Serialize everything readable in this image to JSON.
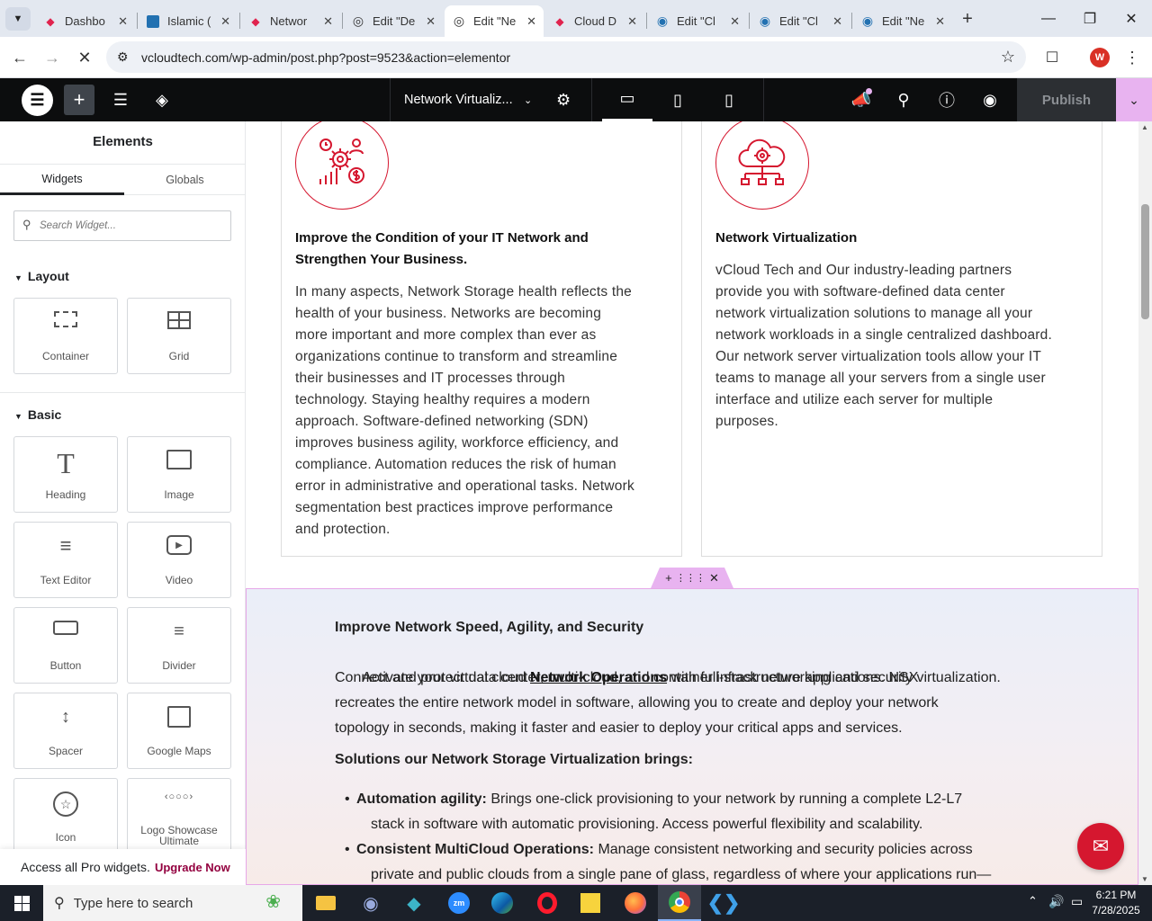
{
  "browser": {
    "tabs": [
      {
        "title": "Dashbo",
        "icon": "diamond-icon",
        "color": "#e0234e"
      },
      {
        "title": "Islamic (",
        "icon": "wp-icon",
        "color": "#2271b1"
      },
      {
        "title": "Networ",
        "icon": "diamond-icon",
        "color": "#e0234e"
      },
      {
        "title": "Edit \"De",
        "icon": "elementor-icon",
        "color": "#333"
      },
      {
        "title": "Edit \"Ne",
        "icon": "elementor-icon",
        "color": "#333"
      },
      {
        "title": "Cloud D",
        "icon": "diamond-icon",
        "color": "#e0234e"
      },
      {
        "title": "Edit \"Cl",
        "icon": "wp-icon",
        "color": "#2271b1"
      },
      {
        "title": "Edit \"Cl",
        "icon": "wp-icon",
        "color": "#2271b1"
      },
      {
        "title": "Edit \"Ne",
        "icon": "wp-icon",
        "color": "#2271b1"
      }
    ],
    "active_tab": 4,
    "url": "vcloudtech.com/wp-admin/post.php?post=9523&action=elementor",
    "profile_letter": "W"
  },
  "editor": {
    "page_title": "Network Virtualiz...",
    "publish_label": "Publish"
  },
  "panel": {
    "title": "Elements",
    "tab_widgets": "Widgets",
    "tab_globals": "Globals",
    "search_placeholder": "Search Widget...",
    "layout_label": "Layout",
    "basic_label": "Basic",
    "layout_items": [
      "Container",
      "Grid"
    ],
    "basic_items": [
      "Heading",
      "Image",
      "Text Editor",
      "Video",
      "Button",
      "Divider",
      "Spacer",
      "Google Maps",
      "Icon",
      "Logo Showcase Ultimate"
    ],
    "promo_text": "Access all Pro widgets.",
    "promo_link": "Upgrade Now"
  },
  "content": {
    "left": {
      "title_line1": "Improve the Condition of your IT Network and",
      "title_line2": "Strengthen Your Business.",
      "lines": [
        "In many aspects, Network Storage health reflects the",
        "health of your business. Networks are becoming",
        "more important and more complex than ever as",
        "organizations continue to transform and streamline",
        "their businesses and IT processes through",
        "technology. Staying healthy requires a modern",
        "approach. Software-defined networking (SDN)",
        "improves business agility, workforce efficiency, and",
        "compliance. Automation reduces the risk of human",
        "error in administrative and operational tasks. Network",
        "segmentation best practices improve performance",
        "and protection."
      ]
    },
    "right": {
      "title": "Network Virtualization",
      "lines": [
        "vCloud Tech and Our industry-leading partners",
        "provide you with software-defined data center",
        "network virtualization solutions to manage all your",
        "network workloads in a single centralized dashboard.",
        "Our network server virtualization tools allow your IT",
        "teams to manage all your servers from a single user",
        "interface and utilize each server for multiple",
        "purposes."
      ]
    },
    "section2": {
      "heading": "Improve Network Speed, Agility, and Security",
      "p1_pre": " Activate your virtual cloud ",
      "p1_link": "Network Operations",
      "p1_post": " with full-stack networking and security virtualization.",
      "lines": [
        "Connect and protect data center, multi-cloud, and container infrastructure applications. NSX",
        "recreates the entire network model in software, allowing you to create and deploy your network",
        "topology in seconds, making it faster and easier to deploy your critical apps and services."
      ],
      "sub_heading": "Solutions our Network Storage Virtualization brings:",
      "bullets": [
        {
          "label": "Automation agility:",
          "line1": " Brings one-click provisioning to your network by running a complete L2-L7",
          "line2": "stack in software with automatic provisioning. Access powerful flexibility and scalability."
        },
        {
          "label": "Consistent MultiCloud Operations:",
          "line1": " Manage consistent networking and security policies across",
          "line2": "private and public clouds from a single pane of glass, regardless of where your applications run—"
        }
      ]
    }
  },
  "taskbar": {
    "search_placeholder": "Type here to search",
    "time": "6:21 PM",
    "date": "7/28/2025"
  },
  "colors": {
    "accent": "#d5172f",
    "elementor_pink": "#e8b3f0",
    "publish_bg": "#2c2f33"
  }
}
